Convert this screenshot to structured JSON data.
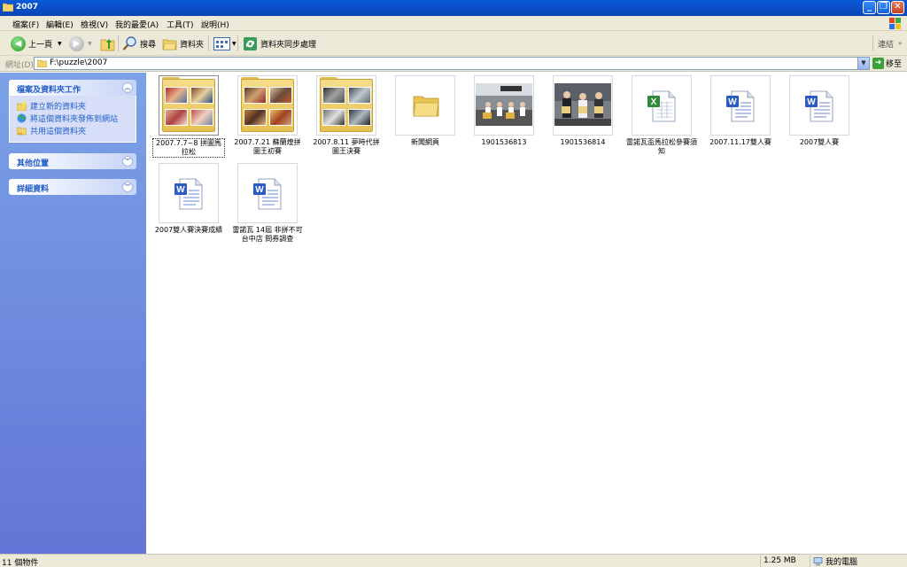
{
  "window": {
    "title": "2007"
  },
  "menu": [
    "檔案(F)",
    "編輯(E)",
    "檢視(V)",
    "我的最愛(A)",
    "工具(T)",
    "說明(H)"
  ],
  "toolbar": {
    "back_label": "上一頁",
    "search_label": "搜尋",
    "folders_label": "資料夾",
    "sync_label": "資料夾同步處理",
    "links_label": "連結"
  },
  "address": {
    "label": "網址(D)",
    "path": "F:\\puzzle\\2007",
    "go_label": "移至"
  },
  "left_panel": {
    "tasks": {
      "title": "檔案及資料夾工作",
      "items": [
        "建立新的資料夾",
        "將這個資料夾發佈到網站",
        "共用這個資料夾"
      ]
    },
    "other_places": {
      "title": "其他位置"
    },
    "details": {
      "title": "詳細資料"
    }
  },
  "items": [
    {
      "label": "2007.7.7~8 拼圖馬拉松",
      "type": "folder",
      "selected": true
    },
    {
      "label": "2007.7.21 蘇蘭煌拼圖王初賽",
      "type": "folder"
    },
    {
      "label": "2007.8.11 夢時代拼圖王決賽",
      "type": "folder"
    },
    {
      "label": "新聞網頁",
      "type": "folder-empty"
    },
    {
      "label": "1901536813",
      "type": "photo"
    },
    {
      "label": "1901536814",
      "type": "photo"
    },
    {
      "label": "雷諾瓦盃馬拉松參賽須知",
      "type": "excel"
    },
    {
      "label": "2007.11.17雙人賽",
      "type": "word"
    },
    {
      "label": "2007雙人賽",
      "type": "word"
    },
    {
      "label": "2007雙人賽決賽成績",
      "type": "word"
    },
    {
      "label": "雷諾瓦 14屆 非拼不可 台中店 問券調查",
      "type": "word"
    }
  ],
  "status": {
    "count": "11 個物件",
    "size": "1.25 MB",
    "location": "我的電腦"
  }
}
